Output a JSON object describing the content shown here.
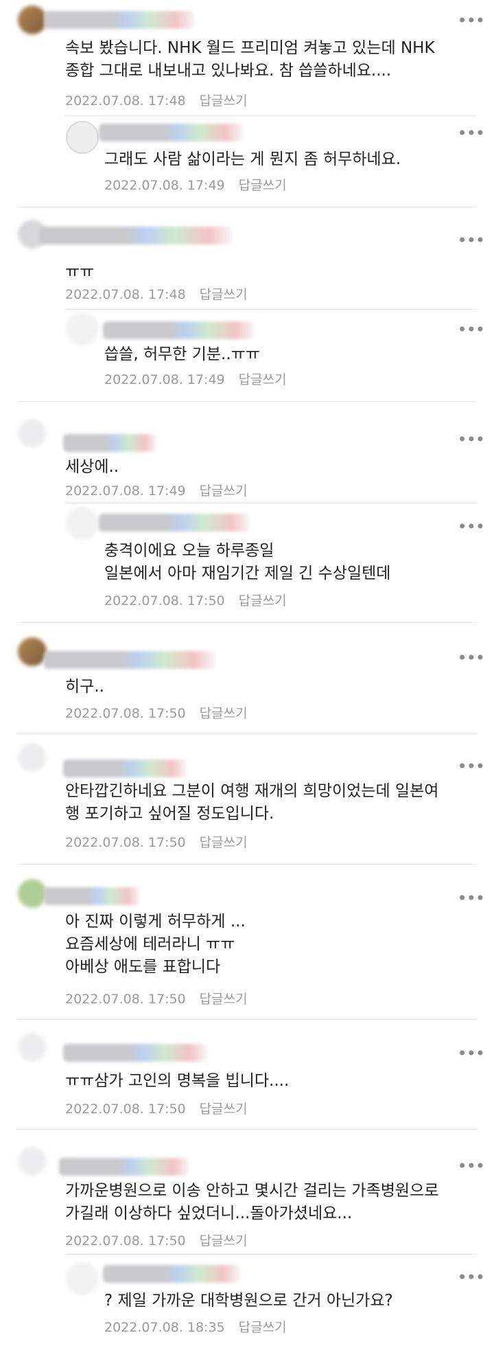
{
  "reply_label": "답글쓰기",
  "comments": [
    {
      "text": "속보 봤습니다. NHK 월드 프리미엄 켜놓고 있는데 NHK\n종합 그대로 내보내고 있나봐요. 참 씁쓸하네요....",
      "date": "2022.07.08. 17:48",
      "reply": {
        "text": "그래도 사람 삶이라는 게 뭔지 좀 허무하네요.",
        "date": "2022.07.08. 17:49"
      }
    },
    {
      "text": "ㅠㅠ",
      "date": "2022.07.08. 17:48",
      "reply": {
        "text": "씁쓸, 허무한 기분..ㅠㅠ",
        "date": "2022.07.08. 17:49"
      }
    },
    {
      "text": "세상에..",
      "date": "2022.07.08. 17:49",
      "reply": {
        "text": "충격이에요 오늘 하루종일\n일본에서 아마 재임기간 제일 긴 수상일텐데",
        "date": "2022.07.08. 17:50"
      }
    },
    {
      "text": "히구..",
      "date": "2022.07.08. 17:50"
    },
    {
      "text": "안타깝긴하네요 그분이 여행 재개의 희망이었는데 일본여\n행 포기하고 싶어질 정도입니다.",
      "date": "2022.07.08. 17:50"
    },
    {
      "text": "아 진짜 이렇게 허무하게 ...\n요즘세상에 테러라니 ㅠㅠ\n아베상 애도를 표합니다",
      "date": "2022.07.08. 17:50"
    },
    {
      "text": "ㅠㅠ삼가 고인의 명복을 빕니다....",
      "date": "2022.07.08. 17:50"
    },
    {
      "text": "가까운병원으로 이송 안하고 몇시간 걸리는 가족병원으로\n가길래 이상하다 싶었더니...돌아가셨네요...",
      "date": "2022.07.08. 17:50",
      "reply": {
        "text": "? 제일 가까운 대학병원으로 간거 아닌가요?",
        "date": "2022.07.08. 18:35"
      }
    }
  ]
}
